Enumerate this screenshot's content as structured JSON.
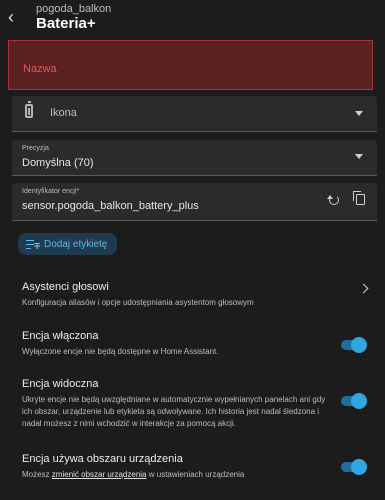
{
  "header": {
    "subtitle": "pogoda_balkon",
    "title": "Bateria+"
  },
  "name_field": {
    "placeholder": "Nazwa"
  },
  "icon_field": {
    "placeholder": "Ikona",
    "icon": "battery-icon"
  },
  "precision": {
    "label": "Precyzja",
    "value": "Domyślna (70)"
  },
  "entity_id": {
    "label": "Identyfikator encji*",
    "prefix": "sensor.",
    "value": "pogoda_balkon_battery_plus"
  },
  "label_button": {
    "text": "Dodaj etykietę"
  },
  "assistants": {
    "title": "Asystenci głosowi",
    "desc": "Konfiguracja aliasów i opcje udostępniania asystentom głosowym"
  },
  "enabled": {
    "title": "Encja włączona",
    "desc": "Wyłączone encje nie będą dostępne w Home Assistant.",
    "on": true
  },
  "visible": {
    "title": "Encja widoczna",
    "desc": "Ukryte encje nie będą uwzględniane w automatycznie wypełnianych panelach ani gdy ich obszar, urządzenie lub etykieta są odwoływane. Ich historia jest nadal śledzona i nadal możesz z nimi wchodzić w interakcje za pomocą akcji.",
    "on": true
  },
  "area": {
    "title": "Encja używa obszaru urządzenia",
    "desc_before": "Możesz",
    "desc_link": "zmienić obszar urządzenia",
    "desc_after": "w ustawieniach urządzenia",
    "on": true
  },
  "colors": {
    "accent": "#2fa7e3",
    "error": "#e05a5a",
    "background": "#1c1c1c"
  }
}
